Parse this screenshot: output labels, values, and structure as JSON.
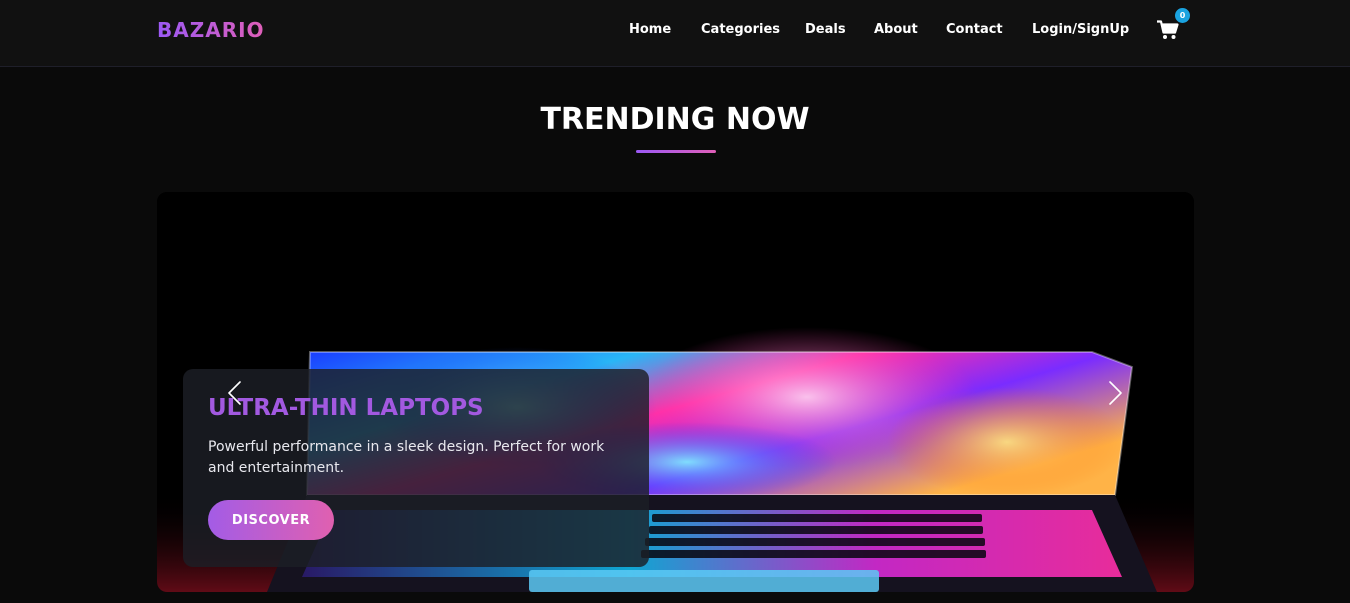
{
  "brand": {
    "name": "BAZARIO",
    "gradient_start": "#9b59f6",
    "gradient_end": "#e05fb8"
  },
  "nav": {
    "items": [
      {
        "label": "Home"
      },
      {
        "label": "Categories"
      },
      {
        "label": "Deals"
      },
      {
        "label": "About"
      },
      {
        "label": "Contact"
      },
      {
        "label": "Login/SignUp"
      }
    ],
    "cart": {
      "icon": "cart-icon",
      "count": "0",
      "badge_color": "#1aa3e0"
    }
  },
  "section": {
    "title": "TRENDING NOW"
  },
  "carousel": {
    "slide": {
      "image_icon": "laptop-image",
      "title": "ULTRA-THIN LAPTOPS",
      "description": "Powerful performance in a sleek design. Perfect for work and entertainment.",
      "button_label": "DISCOVER",
      "title_color": "#a259e0"
    },
    "prev_icon": "chevron-left-icon",
    "next_icon": "chevron-right-icon"
  }
}
